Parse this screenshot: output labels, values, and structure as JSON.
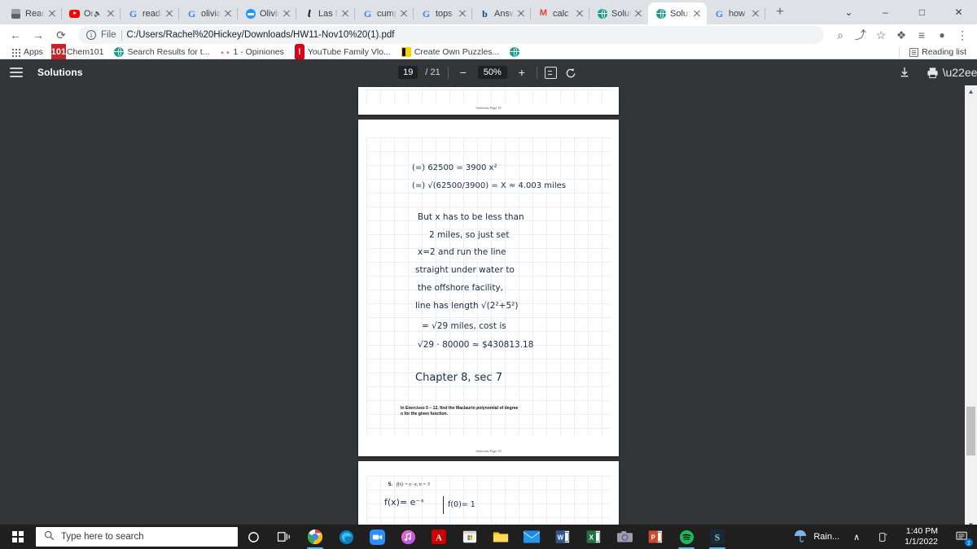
{
  "browser": {
    "tabs": [
      {
        "title": "Read ...",
        "favicon": "book-icon",
        "active": false
      },
      {
        "title": "On ...",
        "favicon": "youtube-icon",
        "active": false,
        "muted": true
      },
      {
        "title": "readin...",
        "favicon": "google-icon",
        "active": false
      },
      {
        "title": "olivia ...",
        "favicon": "google-icon",
        "active": false
      },
      {
        "title": "Olivia ...",
        "favicon": "blue-circle-icon",
        "active": false
      },
      {
        "title": "Las fru...",
        "favicon": "nytimes-icon",
        "active": false
      },
      {
        "title": "cumpl...",
        "favicon": "google-icon",
        "active": false
      },
      {
        "title": "tops - ...",
        "favicon": "google-icon",
        "active": false
      },
      {
        "title": "Answe...",
        "favicon": "bing-icon",
        "active": false
      },
      {
        "title": "calc h...",
        "favicon": "gmail-icon",
        "active": false
      },
      {
        "title": "Soluti...",
        "favicon": "globe-icon",
        "active": false
      },
      {
        "title": "Soluti...",
        "favicon": "globe-icon",
        "active": true
      },
      {
        "title": "how t...",
        "favicon": "google-icon",
        "active": false
      }
    ],
    "new_tab_label": "+",
    "window_controls": {
      "restore_down": "⌄",
      "minimize": "–",
      "maximize": "□",
      "close": "✕"
    },
    "nav": {
      "back": "←",
      "forward": "→",
      "reload": "⟳",
      "info_glyph": "i",
      "scheme_label": "File",
      "url": "C:/Users/Rachel%20Hickey/Downloads/HW11-Nov10%20(1).pdf"
    },
    "nav_right": [
      {
        "name": "search-icon",
        "glyph": "⌕"
      },
      {
        "name": "share-icon",
        "glyph": "⤴"
      },
      {
        "name": "bookmark-star-icon",
        "glyph": "☆"
      },
      {
        "name": "extensions-icon",
        "glyph": "❖"
      },
      {
        "name": "reading-list-icon",
        "glyph": "≡"
      },
      {
        "name": "profile-icon",
        "glyph": "●"
      },
      {
        "name": "chrome-menu-icon",
        "glyph": "⋮"
      }
    ],
    "bookmarks": [
      {
        "label": "Apps",
        "icon": "apps-grid-icon"
      },
      {
        "label": "Chem101",
        "icon": "chem101-icon"
      },
      {
        "label": "Search Results for t...",
        "icon": "globe-icon"
      },
      {
        "label": "1 - Opiniones",
        "icon": "opiniones-icon"
      },
      {
        "label": "YouTube Family Vlo...",
        "icon": "youtube-icon"
      },
      {
        "label": "Create Own Puzzles...",
        "icon": "puzzle-icon"
      },
      {
        "label": "",
        "icon": "globe-icon"
      }
    ],
    "reading_list_label": "Reading list"
  },
  "pdf": {
    "title": "Solutions",
    "menu_icon": "hamburger-menu-icon",
    "current_page": "19",
    "page_separator": "/",
    "total_pages": "21",
    "zoom_out_glyph": "−",
    "zoom_level": "50%",
    "zoom_in_glyph": "+",
    "fit_page_icon": "fit-page-icon",
    "rotate_icon": "rotate-icon",
    "download_icon": "download-icon",
    "print_icon": "print-icon",
    "more_icon": "more-options-icon"
  },
  "document": {
    "page_18_footer": "Solutions Page 18",
    "page_19_footer": "Solutions Page 19",
    "handwriting": [
      "(=)   62500 = 3900 x²",
      "(=)   √(62500/3900)  = X ≈ 4.003 miles",
      "But  x has to be less than",
      "2  miles, so just set",
      "x=2 and run the line",
      "straight under water to",
      "the offshore facility,",
      "line has length √(2²+5²)",
      "= √29 miles, cost is",
      "√29 · 80000 ≈ $430813.18",
      "Chapter 8, sec 7"
    ],
    "printed_instruction": "In Exercises 5 – 12, find the Maclaurin polynomial of degree\nn for the given function.",
    "problem_5_number": "5.",
    "problem_5_function": "f(x) = e−x,    n = 3",
    "problem_5_work_left": "f(x)= e⁻ˣ",
    "problem_5_work_right": "f(0)= 1"
  },
  "taskbar": {
    "start_icon": "windows-start-icon",
    "search_placeholder": "Type here to search",
    "search_icon": "search-icon",
    "cortana_icon": "cortana-icon",
    "taskview_icon": "task-view-icon",
    "apps": [
      {
        "name": "chrome-taskbar-icon",
        "open": true
      },
      {
        "name": "edge-taskbar-icon",
        "open": false
      },
      {
        "name": "zoom-taskbar-icon",
        "open": false
      },
      {
        "name": "itunes-taskbar-icon",
        "open": false
      },
      {
        "name": "acrobat-taskbar-icon",
        "open": false
      },
      {
        "name": "microsoft-store-taskbar-icon",
        "open": false
      },
      {
        "name": "file-explorer-taskbar-icon",
        "open": false
      },
      {
        "name": "mail-taskbar-icon",
        "open": false
      },
      {
        "name": "word-taskbar-icon",
        "open": false
      },
      {
        "name": "excel-taskbar-icon",
        "open": false
      },
      {
        "name": "camera-taskbar-icon",
        "open": false
      },
      {
        "name": "powerpoint-taskbar-icon",
        "open": false
      },
      {
        "name": "spotify-taskbar-icon",
        "open": true
      },
      {
        "name": "app-s-taskbar-icon",
        "open": true
      }
    ],
    "weather_label": "Rain...",
    "weather_icon": "umbrella-icon",
    "tray_expand_glyph": "∧",
    "tray_device_icon": "device-icon",
    "time": "1:40 PM",
    "date": "1/1/2022",
    "notification_icon": "notifications-icon",
    "notification_count": "2"
  }
}
